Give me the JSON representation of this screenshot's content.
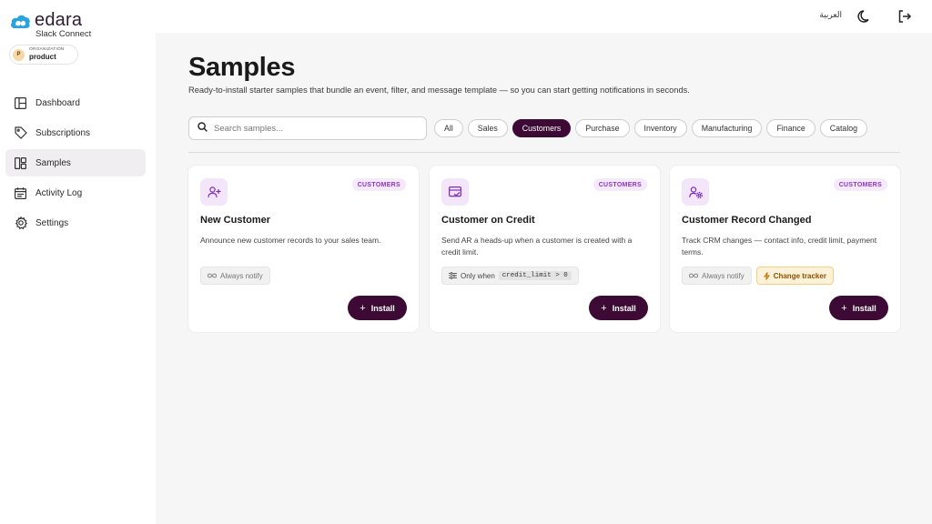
{
  "brand": {
    "name": "edara",
    "subtitle": "Slack Connect"
  },
  "organization": {
    "label": "ORGANIZATION",
    "name": "product",
    "avatar_letter": "P"
  },
  "nav": [
    {
      "label": "Dashboard",
      "icon": "dashboard-icon",
      "active": false
    },
    {
      "label": "Subscriptions",
      "icon": "tag-icon",
      "active": false
    },
    {
      "label": "Samples",
      "icon": "samples-icon",
      "active": true
    },
    {
      "label": "Activity Log",
      "icon": "calendar-icon",
      "active": false
    },
    {
      "label": "Settings",
      "icon": "gear-icon",
      "active": false
    }
  ],
  "topbar": {
    "language": "العربية",
    "theme_icon": "moon-icon",
    "logout_icon": "logout-icon"
  },
  "page": {
    "title": "Samples",
    "subtitle": "Ready-to-install starter samples that bundle an event, filter, and message template — so you can start getting notifications in seconds."
  },
  "search": {
    "placeholder": "Search samples...",
    "value": ""
  },
  "filters": [
    {
      "label": "All",
      "active": false
    },
    {
      "label": "Sales",
      "active": false
    },
    {
      "label": "Customers",
      "active": true
    },
    {
      "label": "Purchase",
      "active": false
    },
    {
      "label": "Inventory",
      "active": false
    },
    {
      "label": "Manufacturing",
      "active": false
    },
    {
      "label": "Finance",
      "active": false
    },
    {
      "label": "Catalog",
      "active": false
    }
  ],
  "cards": [
    {
      "tag": "CUSTOMERS",
      "icon": "user-plus-icon",
      "title": "New Customer",
      "description": "Announce new customer records to your sales team.",
      "badges": [
        {
          "icon": "infinity-icon",
          "text": "Always notify"
        }
      ],
      "install_label": "Install"
    },
    {
      "tag": "CUSTOMERS",
      "icon": "credit-card-icon",
      "title": "Customer on Credit",
      "description": "Send AR a heads-up when a customer is created with a credit limit.",
      "badges": [
        {
          "icon": "filter-icon",
          "text": "Only when",
          "code": "credit_limit > 0"
        }
      ],
      "install_label": "Install"
    },
    {
      "tag": "CUSTOMERS",
      "icon": "user-gear-icon",
      "title": "Customer Record Changed",
      "description": "Track CRM changes — contact info, credit limit, payment terms.",
      "badges": [
        {
          "icon": "infinity-icon",
          "text": "Always notify"
        },
        {
          "icon": "bolt-icon",
          "text": "Change tracker",
          "warn": true
        }
      ],
      "install_label": "Install"
    }
  ],
  "colors": {
    "accent": "#3d0a36",
    "tag_text": "#8a35c8",
    "tag_bg": "#f5e9fc",
    "warn_bg": "#fdf1d8"
  }
}
